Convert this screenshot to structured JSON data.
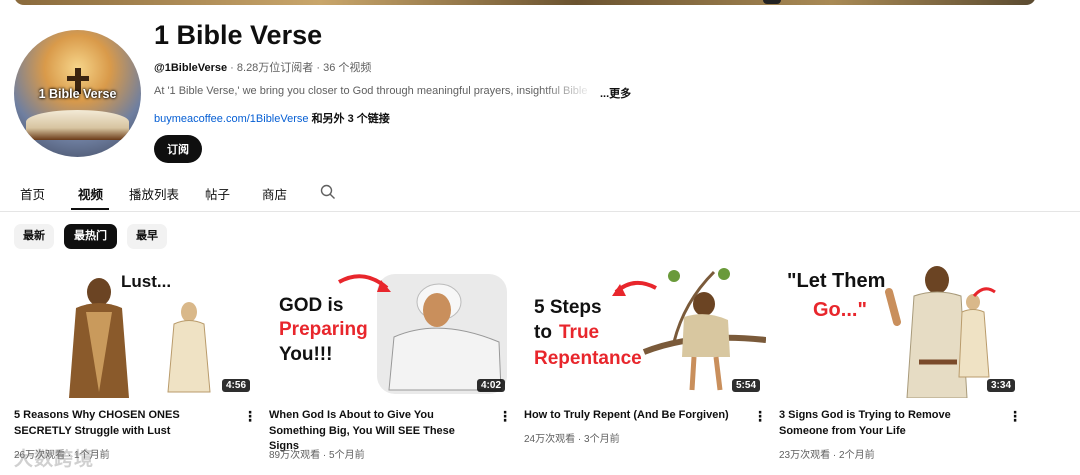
{
  "channel": {
    "name": "1 Bible Verse",
    "handle": "@1BibleVerse",
    "subscribers": "8.28万位订阅者",
    "video_count": "36 个视频",
    "separator": " · ",
    "description": "At '1 Bible Verse,' we bring you closer to God through meaningful prayers, insightful Bible",
    "more_label": "...更多",
    "link_text": "buymeacoffee.com/1BibleVerse",
    "link_extra": "和另外 3 个链接",
    "subscribe_label": "订阅",
    "avatar_text": "1 Bible Verse"
  },
  "tabs": [
    {
      "label": "首页",
      "active": false
    },
    {
      "label": "视频",
      "active": true
    },
    {
      "label": "播放列表",
      "active": false
    },
    {
      "label": "帖子",
      "active": false
    },
    {
      "label": "商店",
      "active": false
    }
  ],
  "chips": [
    {
      "label": "最新",
      "active": false
    },
    {
      "label": "最热门",
      "active": true
    },
    {
      "label": "最早",
      "active": false
    }
  ],
  "videos": [
    {
      "title": "5 Reasons Why CHOSEN ONES SECRETLY Struggle with Lust",
      "views": "26万次观看",
      "age": "1个月前",
      "duration": "4:56",
      "thumb_text": [
        "Lust..."
      ]
    },
    {
      "title": "When God Is About to Give You Something Big, You Will SEE These Signs",
      "views": "89万次观看",
      "age": "5个月前",
      "duration": "4:02",
      "thumb_text": [
        "GOD is",
        "Preparing",
        "You!!!"
      ]
    },
    {
      "title": "How to Truly Repent (And Be Forgiven)",
      "views": "24万次观看",
      "age": "3个月前",
      "duration": "5:54",
      "thumb_text": [
        "5 Steps",
        "to",
        "True",
        "Repentance"
      ]
    },
    {
      "title": "3 Signs God is Trying to Remove Someone from Your Life",
      "views": "23万次观看",
      "age": "2个月前",
      "duration": "3:34",
      "thumb_text": [
        "\"Let Them",
        "Go...\""
      ]
    }
  ],
  "watermark": "大数跨境",
  "colors": {
    "accent_red": "#e8262c",
    "link_blue": "#065fd4",
    "text_muted": "#606060"
  }
}
